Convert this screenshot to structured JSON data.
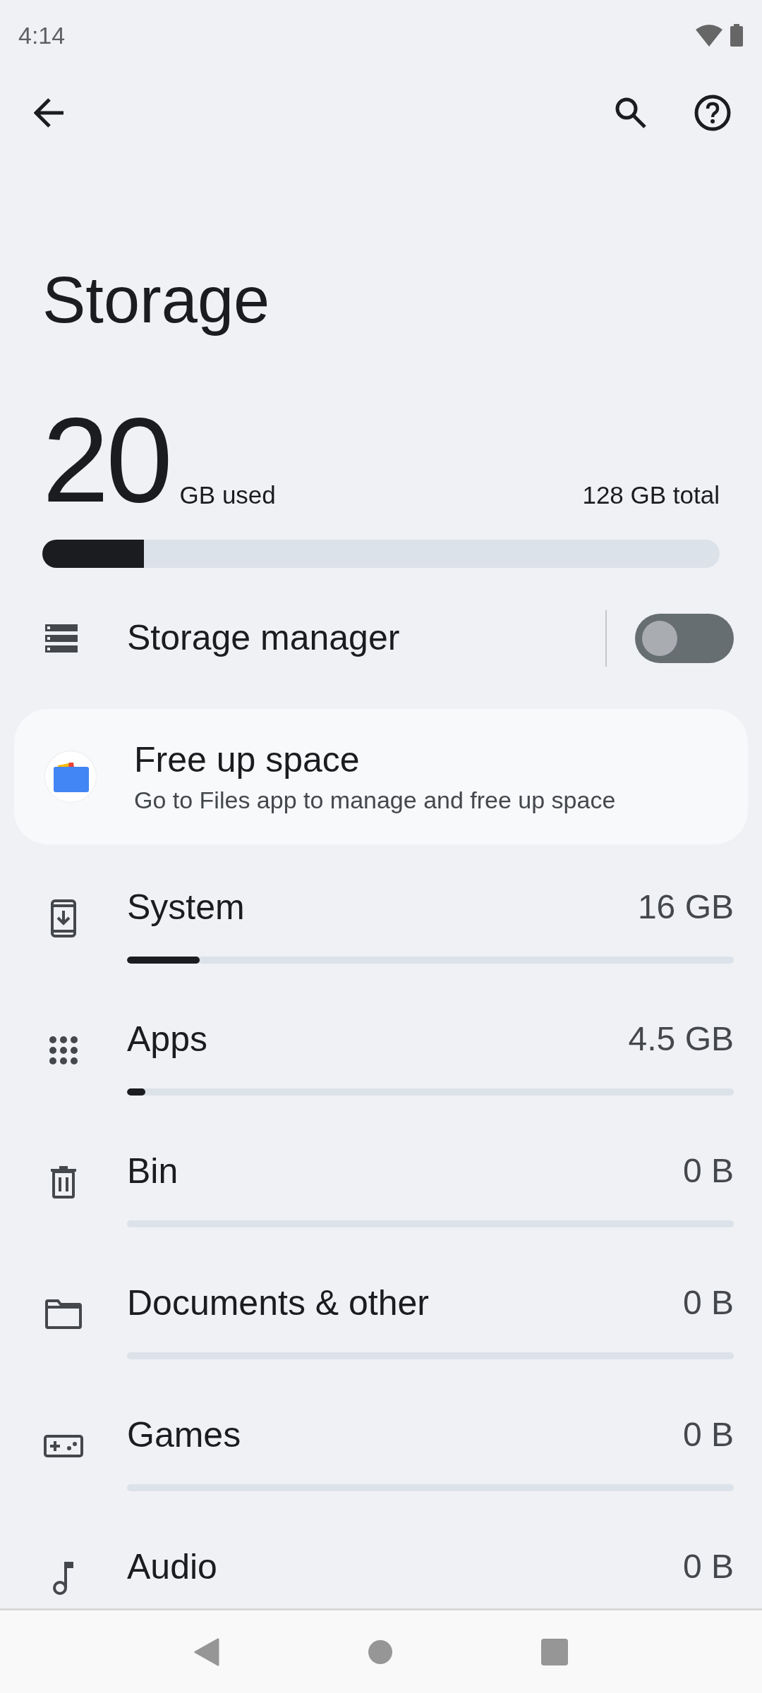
{
  "status_bar": {
    "time": "4:14"
  },
  "title": "Storage",
  "usage": {
    "used": "20",
    "used_unit": "GB used",
    "total": "128 GB total",
    "level": 0.15
  },
  "storage_manager": {
    "label": "Storage manager",
    "on": false
  },
  "free_up_card": {
    "title": "Free up space",
    "subtitle": "Go to Files app to manage and free up space"
  },
  "categories": [
    {
      "kind": "system",
      "label": "System",
      "size": "16 GB",
      "level": 0.12
    },
    {
      "kind": "apps",
      "label": "Apps",
      "size": "4.5 GB",
      "level": 0.03
    },
    {
      "kind": "bin",
      "label": "Bin",
      "size": "0 B",
      "level": 0
    },
    {
      "kind": "documents",
      "label": "Documents & other",
      "size": "0 B",
      "level": 0
    },
    {
      "kind": "games",
      "label": "Games",
      "size": "0 B",
      "level": 0
    },
    {
      "kind": "audio",
      "label": "Audio",
      "size": "0 B"
    }
  ]
}
